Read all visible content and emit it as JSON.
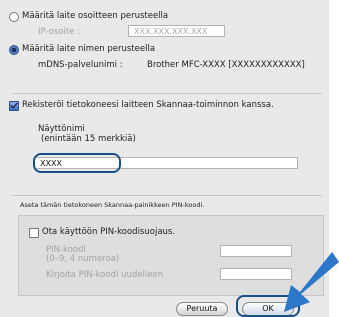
{
  "address_option": {
    "label": "Määritä laite osoitteen perusteella",
    "ip_label": "IP-osoite :",
    "ip_placeholder": "XXX.XXX.XXX.XXX"
  },
  "name_option": {
    "label": "Määritä laite nimen perusteella",
    "mdns_label": "mDNS-palvelunimi :",
    "mdns_value": "Brother MFC-XXXX  [XXXXXXXXXXXX]"
  },
  "register": {
    "label": "Rekisteröi tietokoneesi laitteen Skannaa-toiminnon kanssa.",
    "display_name_label": "Näyttönimi",
    "display_name_hint": "(enintään 15 merkkiä)",
    "display_name_value": "XXXX"
  },
  "pin": {
    "section_label": "Aseta tämän tietokoneen Skannaa-painikkeen PIN-koodi.",
    "enable_label": "Ota käyttöön PIN-koodisuojaus.",
    "pin_label": "PIN-koodi",
    "pin_hint": "(0–9, 4 numeroa)",
    "pin_retype_label": "Kirjoita PIN-koodi uudelleen"
  },
  "buttons": {
    "cancel": "Peruuta",
    "ok": "OK"
  },
  "colors": {
    "highlight": "#1b4f86",
    "arrow": "#2c77c9"
  }
}
